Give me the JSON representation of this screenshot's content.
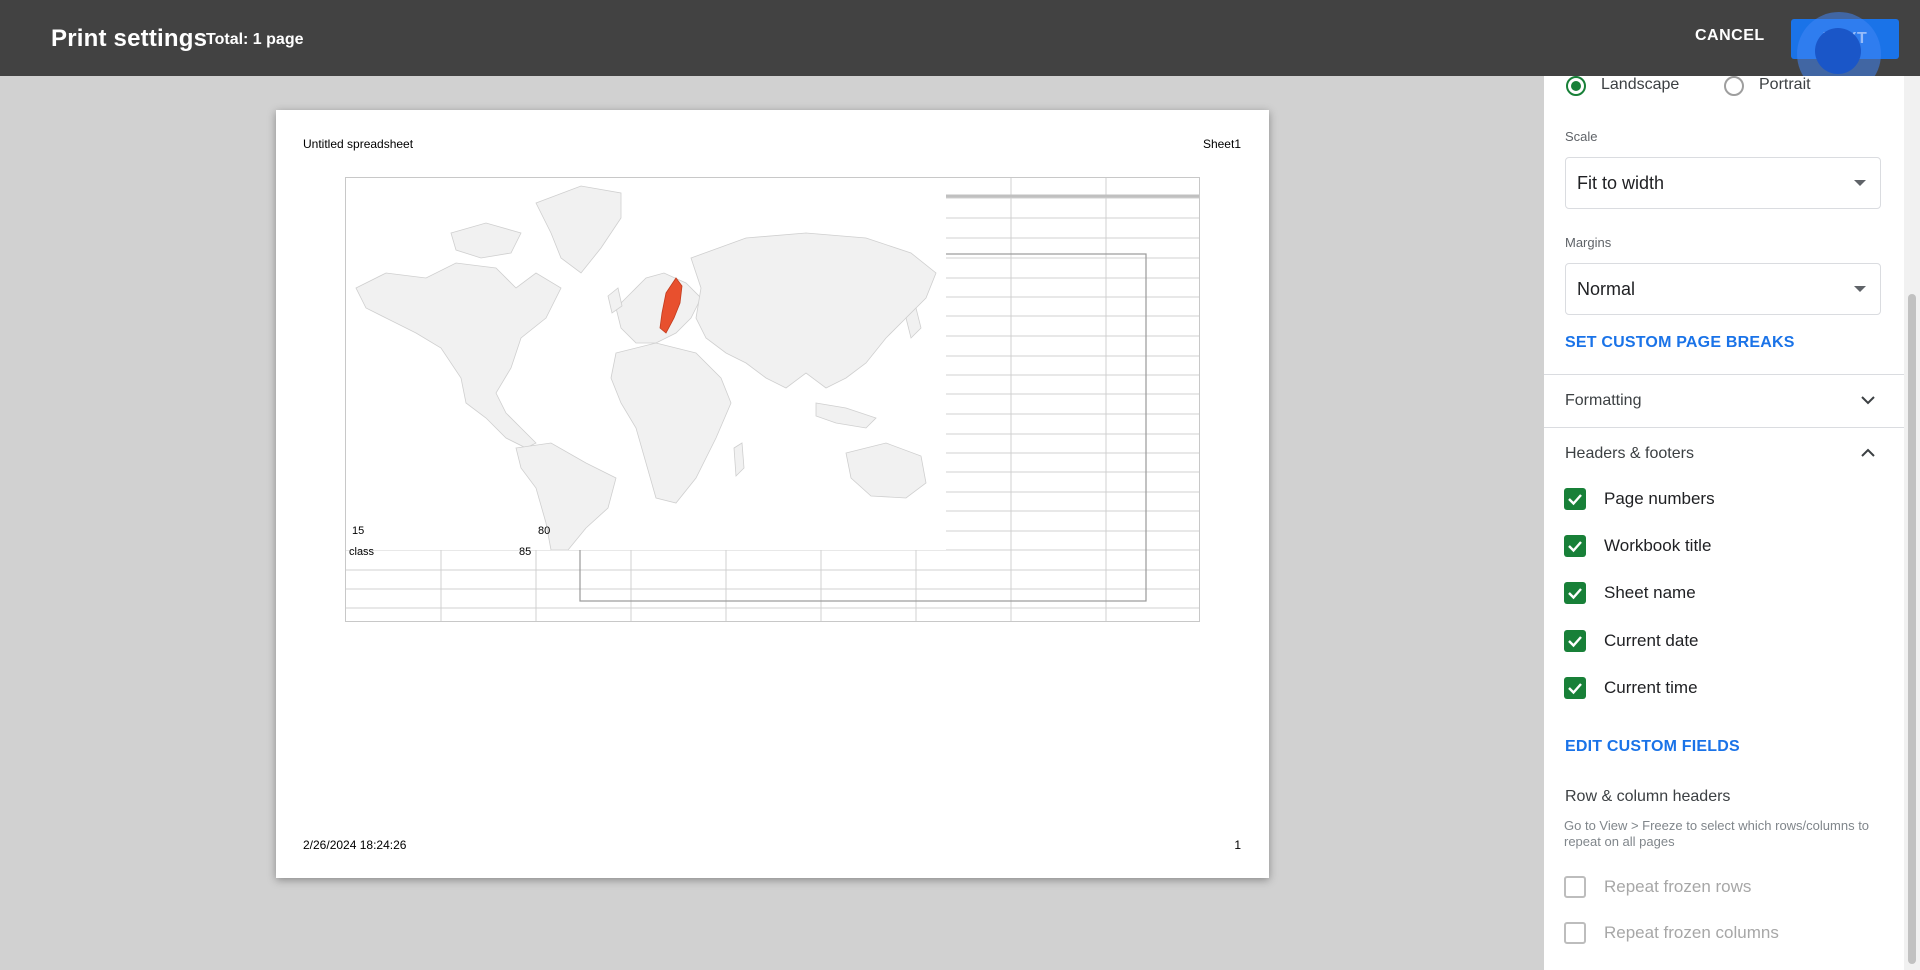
{
  "header": {
    "title": "Print settings",
    "total": "Total: 1 page",
    "cancel_label": "CANCEL",
    "next_label": "NEXT"
  },
  "preview": {
    "header_left": "Untitled spreadsheet",
    "header_right": "Sheet1",
    "footer_left": "2/26/2024 18:24:26",
    "footer_right": "1",
    "map_highlight_color": "#e8502e",
    "cells": {
      "c1": "15",
      "c2": "80",
      "c3": "class",
      "c4": "85"
    }
  },
  "panel": {
    "orientation": {
      "landscape_label": "Landscape",
      "portrait_label": "Portrait",
      "selected": "Landscape"
    },
    "scale": {
      "label": "Scale",
      "value": "Fit to width"
    },
    "margins": {
      "label": "Margins",
      "value": "Normal"
    },
    "custom_breaks_link": "SET CUSTOM PAGE BREAKS",
    "formatting_label": "Formatting",
    "headers_footers_label": "Headers & footers",
    "checkboxes": [
      {
        "label": "Page numbers",
        "checked": true
      },
      {
        "label": "Workbook title",
        "checked": true
      },
      {
        "label": "Sheet name",
        "checked": true
      },
      {
        "label": "Current date",
        "checked": true
      },
      {
        "label": "Current time",
        "checked": true
      }
    ],
    "edit_custom_fields_link": "EDIT CUSTOM FIELDS",
    "row_col_headers_label": "Row & column headers",
    "row_col_help": "Go to View > Freeze to select which rows/columns to repeat on all pages",
    "frozen": [
      {
        "label": "Repeat frozen rows",
        "checked": false
      },
      {
        "label": "Repeat frozen columns",
        "checked": false
      }
    ]
  },
  "colors": {
    "accent": "#1a73e8",
    "check_green": "#188038",
    "topbar": "#424242"
  }
}
